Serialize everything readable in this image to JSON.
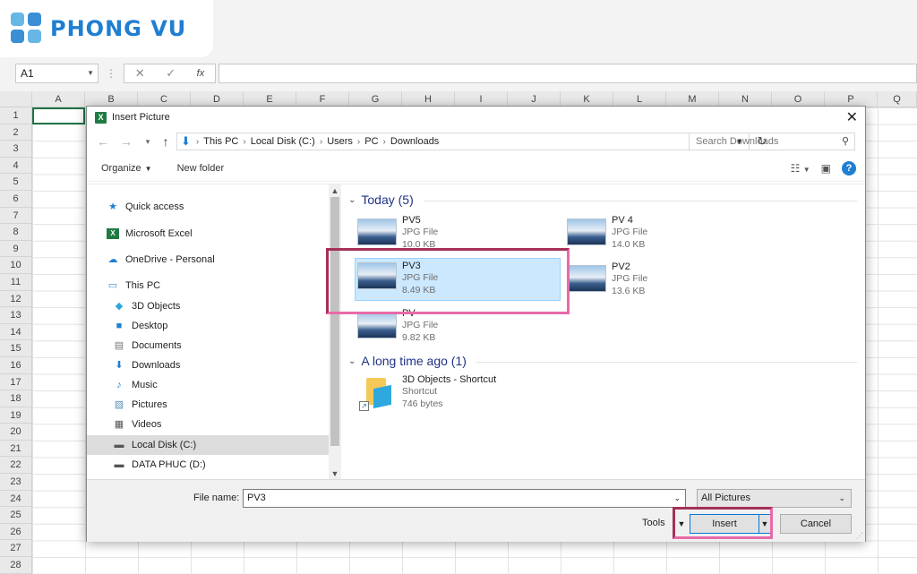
{
  "brand": {
    "name": "PHONG VU"
  },
  "excel": {
    "name_box": "A1",
    "fx": "fx",
    "columns": [
      "A",
      "B",
      "C",
      "D",
      "E",
      "F",
      "G",
      "H",
      "I",
      "J",
      "K",
      "L",
      "M",
      "N",
      "O",
      "P",
      "Q"
    ],
    "rows": [
      "1",
      "2",
      "3",
      "4",
      "5",
      "6",
      "7",
      "8",
      "9",
      "10",
      "11",
      "12",
      "13",
      "14",
      "15",
      "16",
      "17",
      "18",
      "19",
      "20",
      "21",
      "22",
      "23",
      "24",
      "25",
      "26",
      "27",
      "28"
    ]
  },
  "dialog": {
    "title": "Insert Picture",
    "address": [
      "This PC",
      "Local Disk (C:)",
      "Users",
      "PC",
      "Downloads"
    ],
    "search_placeholder": "Search Downloads",
    "toolbar": {
      "organize": "Organize",
      "new_folder": "New folder"
    },
    "nav": [
      {
        "label": "Quick access",
        "icon": "star-icon"
      },
      {
        "label": "Microsoft Excel",
        "icon": "excel-icon"
      },
      {
        "label": "OneDrive - Personal",
        "icon": "cloud-icon"
      },
      {
        "label": "This PC",
        "icon": "computer-icon"
      },
      {
        "label": "3D Objects",
        "icon": "cube-icon"
      },
      {
        "label": "Desktop",
        "icon": "desktop-icon"
      },
      {
        "label": "Documents",
        "icon": "document-icon"
      },
      {
        "label": "Downloads",
        "icon": "download-icon"
      },
      {
        "label": "Music",
        "icon": "music-icon"
      },
      {
        "label": "Pictures",
        "icon": "pictures-icon"
      },
      {
        "label": "Videos",
        "icon": "video-icon"
      },
      {
        "label": "Local Disk (C:)",
        "icon": "disk-icon"
      },
      {
        "label": "DATA PHUC (D:)",
        "icon": "drive-icon"
      }
    ],
    "groups": [
      {
        "label": "Today (5)"
      },
      {
        "label": "A long time ago (1)"
      }
    ],
    "files": [
      {
        "name": "PV5",
        "type": "JPG File",
        "size": "10.0 KB"
      },
      {
        "name": "PV 4",
        "type": "JPG File",
        "size": "14.0 KB"
      },
      {
        "name": "PV3",
        "type": "JPG File",
        "size": "8.49 KB"
      },
      {
        "name": "PV2",
        "type": "JPG File",
        "size": "13.6 KB"
      },
      {
        "name": "PV",
        "type": "JPG File",
        "size": "9.82 KB"
      },
      {
        "name": "3D Objects - Shortcut",
        "type": "Shortcut",
        "size": "746 bytes"
      }
    ],
    "file_name_label": "File name:",
    "file_name_value": "PV3",
    "file_type": "All Pictures",
    "tools_label": "Tools",
    "insert_label": "Insert",
    "cancel_label": "Cancel"
  }
}
